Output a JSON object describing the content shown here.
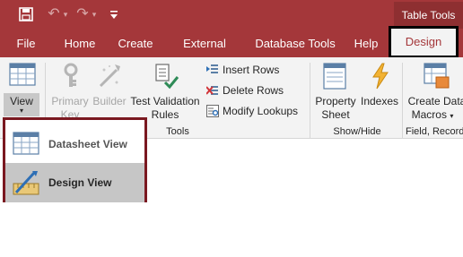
{
  "title_bar": {
    "contextual_tab": "Table Tools"
  },
  "quick_access": {
    "save_icon": "save-icon",
    "undo_icon": "undo-icon",
    "redo_icon": "redo-icon",
    "customize_icon": "customize-qat-icon"
  },
  "tabs": {
    "file": "File",
    "home": "Home",
    "create": "Create",
    "external_data": "External Data",
    "database_tools": "Database Tools",
    "help": "Help",
    "design": "Design"
  },
  "ribbon": {
    "view": {
      "label": "View"
    },
    "primary_key": {
      "line1": "Primary",
      "line2": "Key"
    },
    "builder": {
      "label": "Builder"
    },
    "test_validation": {
      "line1": "Test Validation",
      "line2": "Rules"
    },
    "insert_rows": "Insert Rows",
    "delete_rows": "Delete Rows",
    "modify_lookups": "Modify Lookups",
    "property_sheet": {
      "line1": "Property",
      "line2": "Sheet"
    },
    "indexes": "Indexes",
    "create_data_macros": {
      "line1": "Create Data",
      "line2": "Macros"
    },
    "groups": {
      "tools": "Tools",
      "show_hide": "Show/Hide",
      "field_record": "Field, Record"
    }
  },
  "dropdown": {
    "datasheet_view": "Datasheet View",
    "design_view": "Design View"
  },
  "colors": {
    "accent": "#a4373a",
    "highlight_border": "#000000",
    "dropdown_border": "#7a1820"
  }
}
